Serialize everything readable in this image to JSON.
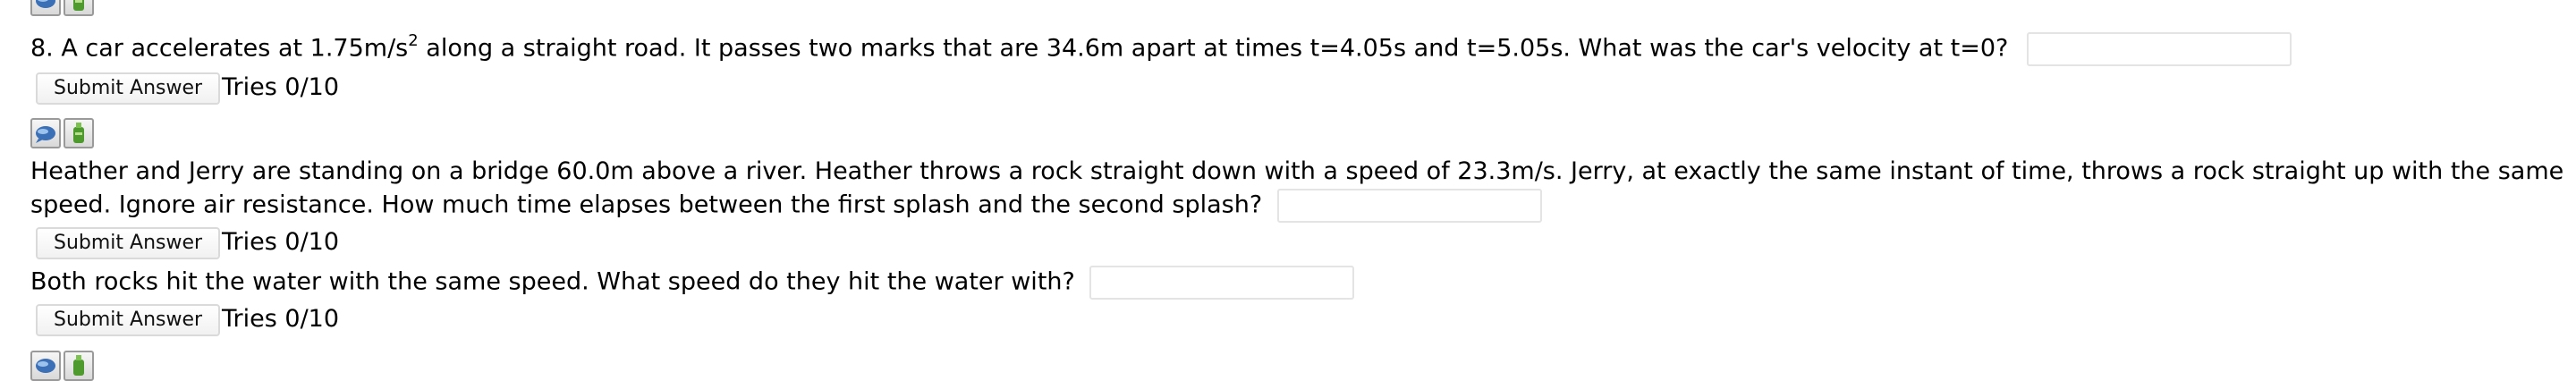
{
  "questions": [
    {
      "number": "8.",
      "text_before_sup": "A car accelerates at 1.75m/s",
      "sup": "2",
      "text_after_sup": " along a straight road. It passes two marks that are 34.6m apart at times t=4.05s and t=5.05s. What was the car's velocity at t=0?",
      "answer_value": "",
      "submit_label": "Submit Answer",
      "tries": "Tries 0/10"
    },
    {
      "line1": "Heather and Jerry are standing on a bridge 60.0m above a river. Heather throws a rock straight down with a speed of 23.3m/s. Jerry, at exactly the same instant of time, throws a rock straight up with the same",
      "line2": "speed. Ignore air resistance. How much time elapses between the first splash and the second splash?",
      "answer_value": "",
      "submit_label": "Submit Answer",
      "tries": "Tries 0/10"
    },
    {
      "text": "Both rocks hit the water with the same speed. What speed do they hit the water with?",
      "answer_value": "",
      "submit_label": "Submit Answer",
      "tries": "Tries 0/10"
    }
  ],
  "icons": {
    "discussion": "discussion-icon",
    "feedback": "feedback-bottle-icon"
  },
  "colors": {
    "field_border": "#e4e4e4",
    "button_border": "#dadada",
    "icon_blue": "#3b6fb6",
    "icon_green": "#4e9a2e"
  }
}
